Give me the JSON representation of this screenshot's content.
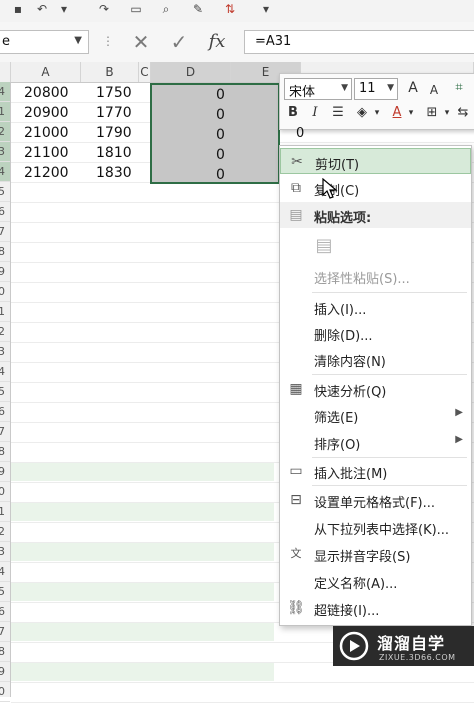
{
  "name_box": {
    "value": "e"
  },
  "formula_bar": {
    "fx_label": "fx",
    "formula": "=A31"
  },
  "columns": [
    "A",
    "B",
    "C",
    "D",
    "E"
  ],
  "rows": [
    {
      "a": "20800",
      "b": "1750",
      "d": "0"
    },
    {
      "a": "20900",
      "b": "1770",
      "d": "0"
    },
    {
      "a": "21000",
      "b": "1790",
      "d": "0"
    },
    {
      "a": "21100",
      "b": "1810",
      "d": "0"
    },
    {
      "a": "21200",
      "b": "1830",
      "d": "0"
    }
  ],
  "row_header_fragments": [
    "4",
    "1",
    "2",
    "3",
    "4",
    "5",
    "6",
    "7",
    "8",
    "9",
    "0",
    "1",
    "2",
    "3",
    "4",
    "5",
    "6",
    "7",
    "8",
    "9",
    "0",
    "1",
    "2",
    "3",
    "4",
    "5",
    "6",
    "7",
    "8",
    "9",
    "0"
  ],
  "mini_toolbar": {
    "font_name": "宋体",
    "font_size": "11",
    "grow_font": "A",
    "shrink_font": "A",
    "bold": "B",
    "italic": "I",
    "extra_cell_value": "0"
  },
  "context_menu": {
    "cut": "剪切(T)",
    "copy": "复制(C)",
    "paste_options": "粘贴选项:",
    "paste_special": "选择性粘贴(S)...",
    "insert": "插入(I)...",
    "delete": "删除(D)...",
    "clear_contents": "清除内容(N)",
    "quick_analysis": "快速分析(Q)",
    "filter": "筛选(E)",
    "sort": "排序(O)",
    "insert_comment": "插入批注(M)",
    "format_cells": "设置单元格格式(F)...",
    "pick_from_list": "从下拉列表中选择(K)...",
    "phonetic": "显示拼音字段(S)",
    "define_name": "定义名称(A)...",
    "hyperlink": "超链接(I)..."
  },
  "watermark": {
    "title": "溜溜自学",
    "subtitle": "ZIXUE.3D66.COM"
  },
  "colors": {
    "accent_green": "#2e6d45",
    "highlight": "#d7ead9",
    "selection_fill": "#c6c6c6"
  }
}
